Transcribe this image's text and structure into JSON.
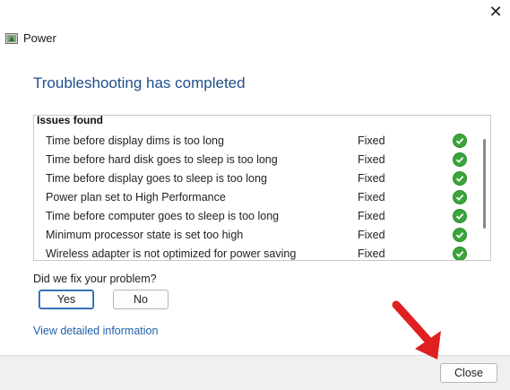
{
  "window": {
    "title": "Power",
    "close_glyph": "✕"
  },
  "main": {
    "heading": "Troubleshooting has completed",
    "issues_header": "Issues found",
    "issues": [
      {
        "name": "Time before display dims is too long",
        "status": "Fixed"
      },
      {
        "name": "Time before hard disk goes to sleep is too long",
        "status": "Fixed"
      },
      {
        "name": "Time before display goes to sleep is too long",
        "status": "Fixed"
      },
      {
        "name": "Power plan set to High Performance",
        "status": "Fixed"
      },
      {
        "name": "Time before computer goes to sleep is too long",
        "status": "Fixed"
      },
      {
        "name": "Minimum processor state is set too high",
        "status": "Fixed"
      },
      {
        "name": "Wireless adapter is not optimized for power saving",
        "status": "Fixed"
      }
    ],
    "question": "Did we fix your problem?",
    "yes_label": "Yes",
    "no_label": "No",
    "details_link": "View detailed information"
  },
  "footer": {
    "close_label": "Close"
  },
  "colors": {
    "heading": "#1f4f8b",
    "link": "#1f5fa8",
    "check": "#3aa53a",
    "arrow": "#e02020"
  },
  "icons": [
    "close-icon",
    "power-troubleshooter-icon",
    "check-circle-icon",
    "pointer-arrow-icon"
  ]
}
